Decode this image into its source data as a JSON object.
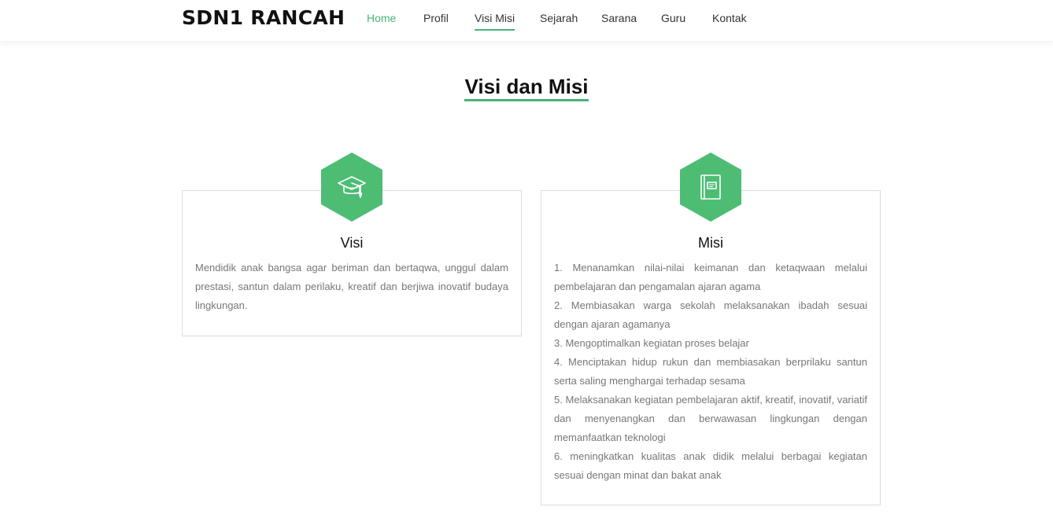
{
  "brand": {
    "name": "SDN1 RANCAH",
    "accent_color": "#47b475"
  },
  "nav": {
    "items": [
      {
        "label": "Home"
      },
      {
        "label": "Profil"
      },
      {
        "label": "Visi Misi"
      },
      {
        "label": "Sejarah"
      },
      {
        "label": "Sarana"
      },
      {
        "label": "Guru"
      },
      {
        "label": "Kontak"
      }
    ],
    "active": "Visi Misi"
  },
  "page": {
    "title": "Visi dan Misi"
  },
  "visi": {
    "icon": "graduation-cap-icon",
    "title": "Visi",
    "text": "Mendidik anak bangsa agar beriman dan bertaqwa, unggul dalam prestasi, santun dalam perilaku, kreatif dan berjiwa inovatif budaya lingkungan."
  },
  "misi": {
    "icon": "book-icon",
    "title": "Misi",
    "items": [
      "1. Menanamkan nilai-nilai keimanan dan ketaqwaan melalui pembelajaran dan pengamalan ajaran agama",
      "2. Membiasakan warga sekolah melaksanakan ibadah sesuai dengan ajaran agamanya",
      "3. Mengoptimalkan kegiatan proses belajar",
      "4. Menciptakan hidup rukun dan membiasakan berprilaku santun serta saling menghargai terhadap sesama",
      "5. Melaksanakan kegiatan pembelajaran aktif, kreatif, inovatif, variatif dan menyenangkan dan berwawasan lingkungan dengan memanfaatkan teknologi",
      "6. meningkatkan kualitas anak didik melalui berbagai kegiatan sesuai dengan minat dan bakat anak"
    ]
  }
}
